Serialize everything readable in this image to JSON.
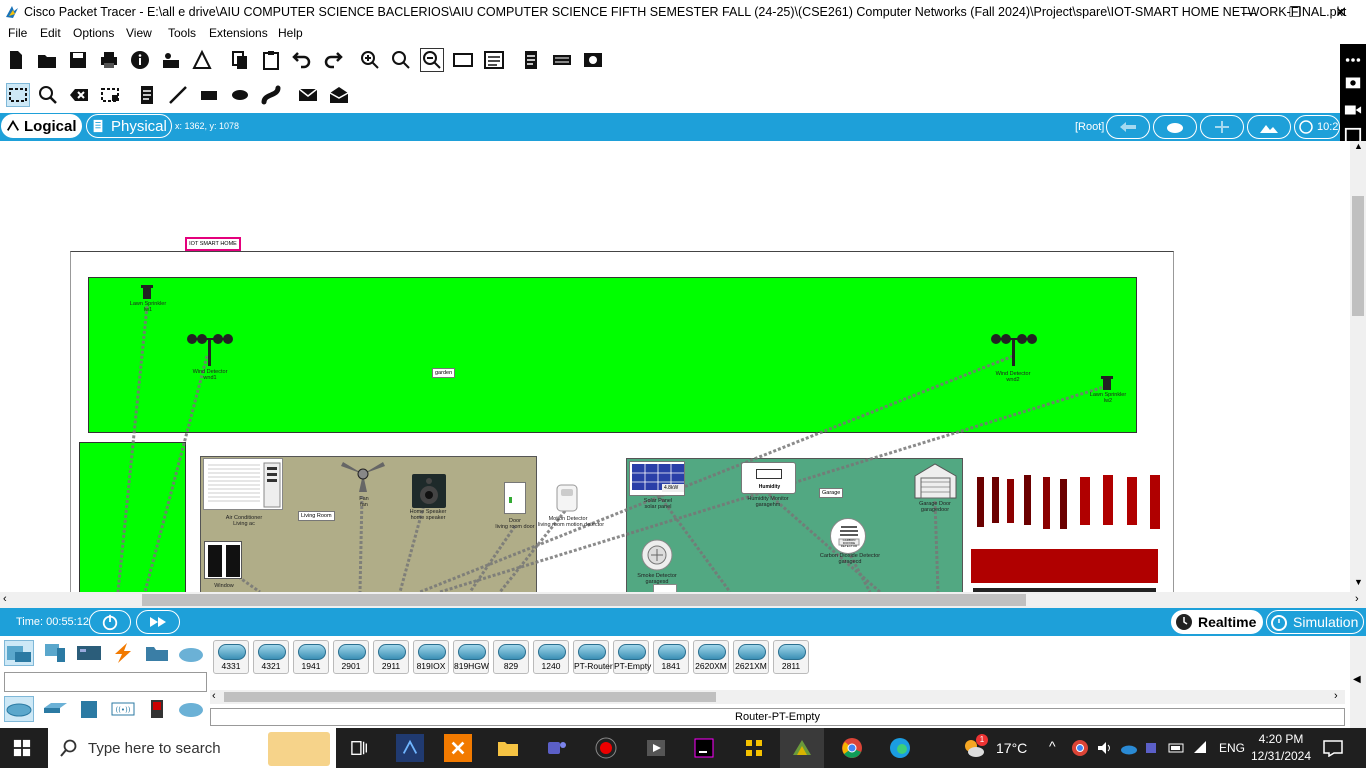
{
  "window": {
    "title": "Cisco Packet Tracer - E:\\all e drive\\AIU COMPUTER SCIENCE BACLERIOS\\AIU COMPUTER SCIENCE FIFTH SEMESTER FALL (24-25)\\(CSE261) Computer Networks (Fall 2024)\\Project\\spare\\IOT-SMART HOME NETWORK-FINAL.pkt",
    "minimize": "—",
    "restore": "❐",
    "close": "✕"
  },
  "menu": [
    "File",
    "Edit",
    "Options",
    "View",
    "Tools",
    "Extensions",
    "Help"
  ],
  "viewbar": {
    "logical": "Logical",
    "physical": "Physical",
    "coords": "x: 1362, y: 1078",
    "root": "[Root]",
    "clock": "10:2"
  },
  "workspace": {
    "title_note": "IOT SMART HOME",
    "garden": "garden",
    "living_room": "Living Room",
    "garage": "Garage",
    "devices": {
      "lawn1_a": "Lawn Sprinkler",
      "lawn1_b": "lw1",
      "wind1_a": "Wind Detector",
      "wind1_b": "wnd1",
      "wind2_a": "Wind Detector",
      "wind2_b": "wnd2",
      "lawn2_a": "Lawn Sprinkler",
      "lawn2_b": "lw2",
      "ac_a": "Air Conditioner",
      "ac_b": "Living ac",
      "fan_a": "Fan",
      "fan_b": "fan",
      "speaker_a": "Home Speaker",
      "speaker_b": "home speaker",
      "door_a": "Door",
      "door_b": "living room door",
      "motion_a": "Motion Detector",
      "motion_b": "living room motion detector",
      "window": "Window",
      "solar_a": "Solar Panel",
      "solar_b": "solar panel",
      "humidity_a": "Humidity Monitor",
      "humidity_b": "garagehm",
      "garagedoor_a": "Garage Door",
      "garagedoor_b": "garagedoor",
      "smoke_a": "Smoke Detector",
      "smoke_b": "garagesd",
      "co_a": "Carbon Dioxide Detector",
      "co_b": "garagecd",
      "solar_display": "4.8kW",
      "humidity_display": "Humidity",
      "co_display": "CARBON DIOXIDE DETECTOR"
    }
  },
  "simbar": {
    "time": "Time: 00:55:12",
    "realtime": "Realtime",
    "simulation": "Simulation"
  },
  "devices": [
    "4331",
    "4321",
    "1941",
    "2901",
    "2911",
    "819IOX",
    "819HGW",
    "829",
    "1240",
    "PT-Router",
    "PT-Empty",
    "1841",
    "2620XM",
    "2621XM",
    "2811"
  ],
  "selected_device": "Router-PT-Empty",
  "taskbar": {
    "search_placeholder": "Type here to search",
    "weather": "17°C",
    "lang": "ENG",
    "time": "4:20 PM",
    "date": "12/31/2024",
    "weather_badge": "1"
  },
  "colors": {
    "accent": "#1ea0d9",
    "garden": "#00ff00",
    "living_room": "#b0ad88",
    "garage": "#52a882",
    "fence": "#8b0000"
  }
}
